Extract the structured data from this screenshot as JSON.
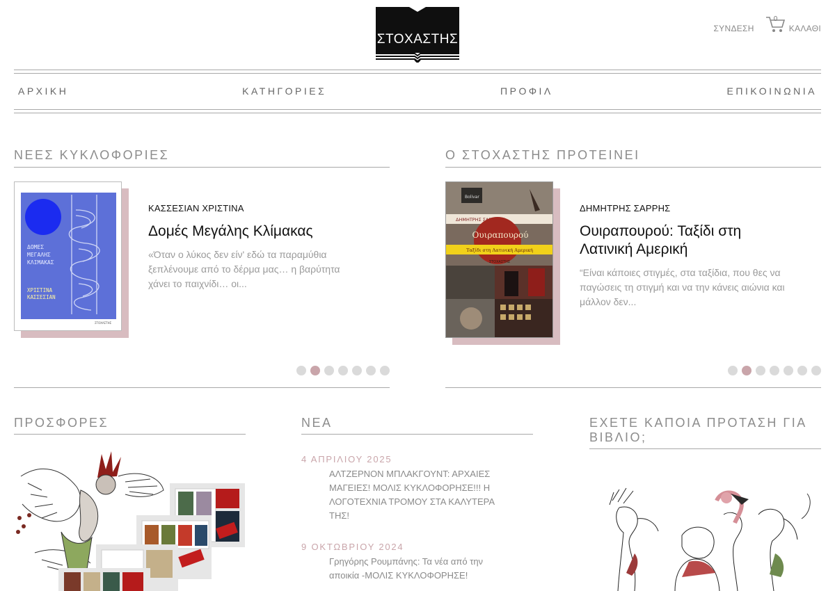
{
  "header": {
    "logo_text": "ΣΤΟΧΑΣΤΗΣ",
    "login_label": "ΣΥΝΔΕΣΗ",
    "cart_label": "ΚΑΛΑΘΙ",
    "cart_count": "0"
  },
  "nav": {
    "items": [
      "ΑΡΧΙΚΗ",
      "ΚΑΤΗΓΟΡΙΕΣ",
      "ΠΡΟΦΙΛ",
      "ΕΠΙΚΟΙΝΩΝΙΑ"
    ]
  },
  "new_releases": {
    "title": "ΝΕΕΣ ΚΥΚΛΟΦΟΡΙΕΣ",
    "author": "ΚΑΣΣΕΣΙΑΝ ΧΡΙΣΤΙΝΑ",
    "book_title": "Δομές Μεγάλης Κλίμακας",
    "excerpt_lines": [
      "«Όταν ο λύκος δεν είν' εδώ τα παραμύθια",
      "ξεπλένουμε από το δέρμα μας… η βαρύτητα",
      "χάνει το παιχνίδι… οι..."
    ],
    "cover_title_lines": [
      "ΔΟΜΕΣ",
      "ΜΕΓΑΛΗΣ",
      "ΚΛΙΜΑΚΑΣ"
    ],
    "cover_author_lines": [
      "ΧΡΙΣΤΙΝΑ",
      "ΚΑΣΣΕΣΙΑΝ"
    ],
    "cover_publisher": "ΣΤΟΧΑΣΤΗΣ",
    "slides": 7,
    "active_slide": 2
  },
  "recommends": {
    "title": "Ο ΣΤΟΧΑΣΤΗΣ ΠΡΟΤΕΙΝΕΙ",
    "author": "ΔΗΜΗΤΡΗΣ ΣΑΡΡΗΣ",
    "book_title_lines": [
      "Ουιραπουρού: Ταξίδι στη",
      "Λατινική Αμερική"
    ],
    "excerpt_lines": [
      "“Είναι κάποιες στιγμές, στα ταξίδια, που θες να",
      "παγώσεις τη στιγμή και να την κάνεις αιώνια και",
      "μάλλον δεν..."
    ],
    "cover_author": "ΔΗΜΗΤΡΗΣ ΣΑΡΡΗΣ",
    "cover_title": "Ουιραπουρού",
    "cover_subtitle": "Ταξίδι στη Λατινική Αμερική",
    "cover_publisher": "ΣΤΟΧΑΣΤΗΣ",
    "cover_sign": "Bolivar",
    "slides": 7,
    "active_slide": 2
  },
  "offers": {
    "title": "ΠΡΟΣΦΟΡΕΣ"
  },
  "news": {
    "title": "ΝΕΑ",
    "items": [
      {
        "date": "4 ΑΠΡΙΛΙΟΥ 2025",
        "lines": [
          "ΑΛΤΖΕΡΝΟΝ ΜΠΛΑΚΓΟΥΝΤ: ΑΡΧΑΙΕΣ",
          "ΜΑΓΕΙΕΣ! ΜΟΛΙΣ ΚΥΚΛΟΦΟΡΗΣΕ!!! Η",
          "ΛΟΓΟΤΕΧΝΙΑ ΤΡΟΜΟΥ ΣΤΑ ΚΑΛΥΤΕΡΑ",
          "ΤΗΣ!"
        ]
      },
      {
        "date": "9 ΟΚΤΩΒΡΙΟΥ 2024",
        "lines": [
          "Γρηγόρης Ρουμπάνης: Τα νέα από την",
          "αποικία -ΜΟΛΙΣ ΚΥΚΛΟΦΟΡΗΣΕ!"
        ]
      }
    ]
  },
  "proposal": {
    "title_lines": [
      "ΕΧΕΤΕ ΚΑΠΟΙΑ ΠΡΟΤΑΣΗ ΓΙΑ",
      "ΒΙΒΛΙΟ;"
    ]
  },
  "colors": {
    "accent_pink": "#c9a5aa",
    "shadow_pink": "#d8bcc0",
    "heading_gray": "#8c8c8c",
    "logo_black": "#0f0f0f"
  }
}
